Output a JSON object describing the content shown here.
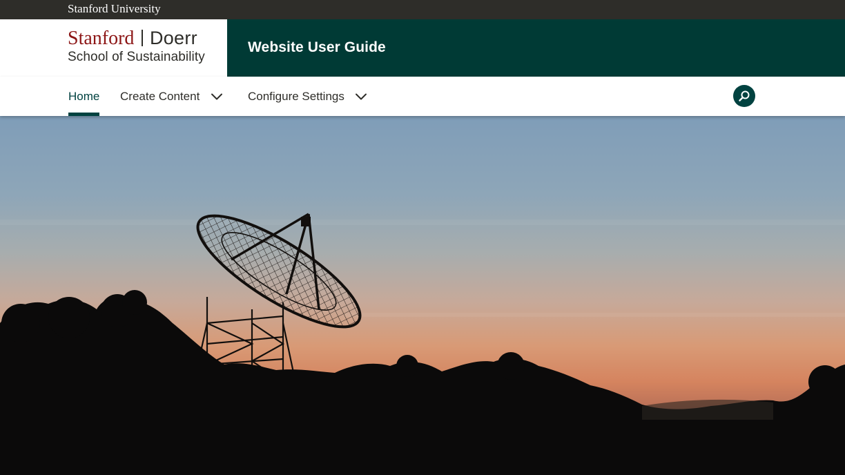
{
  "global_bar": {
    "link_label": "Stanford University"
  },
  "masthead": {
    "logo_primary": "Stanford",
    "logo_secondary": "Doerr",
    "logo_sub": "School of Sustainability",
    "site_title": "Website User Guide"
  },
  "nav": {
    "items": [
      {
        "label": "Home",
        "active": true
      },
      {
        "label": "Create Content",
        "has_submenu": true
      },
      {
        "label": "Configure Settings",
        "has_submenu": true
      }
    ],
    "search_icon": "search-icon"
  },
  "colors": {
    "global_bar": "#2e2d29",
    "stanford_red": "#8c1515",
    "site_title_band": "#003a35",
    "nav_active": "#014240"
  },
  "hero": {
    "subject": "radio-telescope-dish-silhouette-at-sunset"
  }
}
